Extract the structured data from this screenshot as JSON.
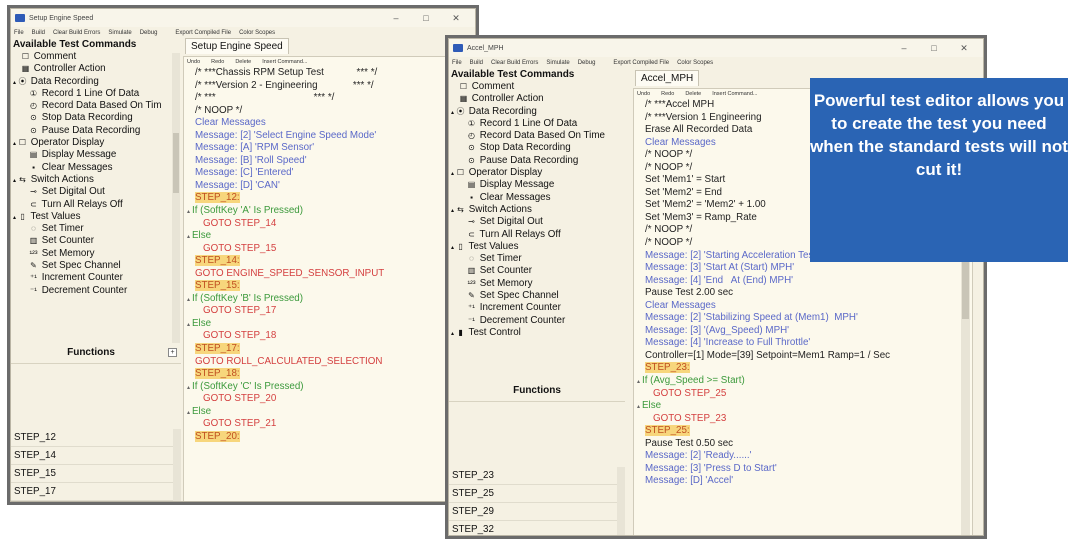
{
  "window1": {
    "title": "Setup Engine Speed",
    "menu": [
      "File",
      "Build",
      "Clear Build Errors",
      "Simulate",
      "Debug"
    ],
    "menu_right": [
      "Export Compiled File",
      "Color Scopes"
    ],
    "panel_header": "Available Test Commands",
    "tab": "Setup Engine Speed",
    "toolbar": [
      "Undo",
      "Redo",
      "Delete",
      "Insert Command..."
    ],
    "functions_label": "Functions",
    "steps": [
      "STEP_12",
      "STEP_14",
      "STEP_15",
      "STEP_17"
    ]
  },
  "window2": {
    "title": "Accel_MPH",
    "menu": [
      "File",
      "Build",
      "Clear Build Errors",
      "Simulate",
      "Debug"
    ],
    "menu_right": [
      "Export Compiled File",
      "Color Scopes"
    ],
    "panel_header": "Available Test Commands",
    "tab": "Accel_MPH",
    "toolbar": [
      "Undo",
      "Redo",
      "Delete",
      "Insert Command..."
    ],
    "functions_label": "Functions",
    "steps": [
      "STEP_23",
      "STEP_25",
      "STEP_29",
      "STEP_32"
    ]
  },
  "commands": {
    "w1": [
      {
        "t": "Comment",
        "icon": "comment-icon",
        "g": "☐",
        "lv": 0
      },
      {
        "t": "Controller Action",
        "icon": "controller-icon",
        "g": "▦",
        "lv": 0
      },
      {
        "t": "Data Recording",
        "icon": "record-icon",
        "g": "⦿",
        "lv": 0,
        "grp": true
      },
      {
        "t": "Record 1 Line Of Data",
        "icon": "record-line-icon",
        "g": "①",
        "lv": 1
      },
      {
        "t": "Record Data Based On Tim",
        "icon": "record-time-icon",
        "g": "◴",
        "lv": 1
      },
      {
        "t": "Stop Data Recording",
        "icon": "stop-icon",
        "g": "⊙",
        "lv": 1
      },
      {
        "t": "Pause Data Recording",
        "icon": "pause-icon",
        "g": "⊙",
        "lv": 1
      },
      {
        "t": "Operator Display",
        "icon": "display-icon",
        "g": "☐",
        "lv": 0,
        "grp": true
      },
      {
        "t": "Display Message",
        "icon": "message-icon",
        "g": "▤",
        "lv": 1
      },
      {
        "t": "Clear Messages",
        "icon": "clear-icon",
        "g": "▪",
        "lv": 1
      },
      {
        "t": "Switch Actions",
        "icon": "switch-icon",
        "g": "⇆",
        "lv": 0,
        "grp": true
      },
      {
        "t": "Set Digital Out",
        "icon": "digital-out-icon",
        "g": "⊸",
        "lv": 1
      },
      {
        "t": "Turn All Relays Off",
        "icon": "relays-icon",
        "g": "⊂",
        "lv": 1
      },
      {
        "t": "Test Values",
        "icon": "test-values-icon",
        "g": "▯",
        "lv": 0,
        "grp": true
      },
      {
        "t": "Set Timer",
        "icon": "timer-icon",
        "g": "◌",
        "lv": 1
      },
      {
        "t": "Set Counter",
        "icon": "counter-icon",
        "g": "▥",
        "lv": 1
      },
      {
        "t": "Set Memory",
        "icon": "memory-icon",
        "g": "¹²³",
        "lv": 1
      },
      {
        "t": "Set Spec Channel",
        "icon": "spec-icon",
        "g": "✎",
        "lv": 1
      },
      {
        "t": "Increment Counter",
        "icon": "increment-icon",
        "g": "⁺¹",
        "lv": 1
      },
      {
        "t": "Decrement Counter",
        "icon": "decrement-icon",
        "g": "⁻¹",
        "lv": 1
      }
    ],
    "w2": [
      {
        "t": "Comment",
        "icon": "comment-icon",
        "g": "☐",
        "lv": 0
      },
      {
        "t": "Controller Action",
        "icon": "controller-icon",
        "g": "▦",
        "lv": 0
      },
      {
        "t": "Data Recording",
        "icon": "record-icon",
        "g": "⦿",
        "lv": 0,
        "grp": true
      },
      {
        "t": "Record 1 Line Of Data",
        "icon": "record-line-icon",
        "g": "①",
        "lv": 1
      },
      {
        "t": "Record Data Based On Time",
        "icon": "record-time-icon",
        "g": "◴",
        "lv": 1
      },
      {
        "t": "Stop Data Recording",
        "icon": "stop-icon",
        "g": "⊙",
        "lv": 1
      },
      {
        "t": "Pause Data Recording",
        "icon": "pause-icon",
        "g": "⊙",
        "lv": 1
      },
      {
        "t": "Operator Display",
        "icon": "display-icon",
        "g": "☐",
        "lv": 0,
        "grp": true
      },
      {
        "t": "Display Message",
        "icon": "message-icon",
        "g": "▤",
        "lv": 1
      },
      {
        "t": "Clear Messages",
        "icon": "clear-icon",
        "g": "▪",
        "lv": 1
      },
      {
        "t": "Switch Actions",
        "icon": "switch-icon",
        "g": "⇆",
        "lv": 0,
        "grp": true
      },
      {
        "t": "Set Digital Out",
        "icon": "digital-out-icon",
        "g": "⊸",
        "lv": 1
      },
      {
        "t": "Turn All Relays Off",
        "icon": "relays-icon",
        "g": "⊂",
        "lv": 1
      },
      {
        "t": "Test Values",
        "icon": "test-values-icon",
        "g": "▯",
        "lv": 0,
        "grp": true
      },
      {
        "t": "Set Timer",
        "icon": "timer-icon",
        "g": "◌",
        "lv": 1
      },
      {
        "t": "Set Counter",
        "icon": "counter-icon",
        "g": "▥",
        "lv": 1
      },
      {
        "t": "Set Memory",
        "icon": "memory-icon",
        "g": "¹²³",
        "lv": 1
      },
      {
        "t": "Set Spec Channel",
        "icon": "spec-icon",
        "g": "✎",
        "lv": 1
      },
      {
        "t": "Increment Counter",
        "icon": "increment-icon",
        "g": "⁺¹",
        "lv": 1
      },
      {
        "t": "Decrement Counter",
        "icon": "decrement-icon",
        "g": "⁻¹",
        "lv": 1
      },
      {
        "t": "Test Control",
        "icon": "test-control-icon",
        "g": "▮",
        "lv": 0,
        "grp": true
      }
    ]
  },
  "editor1": [
    {
      "t": "/* ***Chassis RPM Setup Test            *** */",
      "c": ""
    },
    {
      "t": "/* ***Version 2 - Engineering             *** */",
      "c": ""
    },
    {
      "t": "/* ***                                    *** */",
      "c": ""
    },
    {
      "t": "/* NOOP */",
      "c": ""
    },
    {
      "t": "Clear Messages",
      "c": "blue"
    },
    {
      "t": "Message: [2] 'Select Engine Speed Mode'",
      "c": "blue"
    },
    {
      "t": "Message: [A] 'RPM Sensor'",
      "c": "blue"
    },
    {
      "t": "Message: [B] 'Roll Speed'",
      "c": "blue"
    },
    {
      "t": "Message: [C] 'Entered'",
      "c": "blue"
    },
    {
      "t": "Message: [D] 'CAN'",
      "c": "blue"
    },
    {
      "t": "STEP_12:",
      "c": "step"
    },
    {
      "t": "If (SoftKey 'A' Is Pressed)",
      "c": "green",
      "mk": true
    },
    {
      "t": "GOTO STEP_14",
      "c": "red",
      "ind": true
    },
    {
      "t": "Else",
      "c": "green",
      "mk": true
    },
    {
      "t": "GOTO STEP_15",
      "c": "red",
      "ind": true
    },
    {
      "t": "STEP_14:",
      "c": "step"
    },
    {
      "t": "GOTO ENGINE_SPEED_SENSOR_INPUT",
      "c": "red"
    },
    {
      "t": "STEP_15:",
      "c": "step"
    },
    {
      "t": "If (SoftKey 'B' Is Pressed)",
      "c": "green",
      "mk": true
    },
    {
      "t": "GOTO STEP_17",
      "c": "red",
      "ind": true
    },
    {
      "t": "Else",
      "c": "green",
      "mk": true
    },
    {
      "t": "GOTO STEP_18",
      "c": "red",
      "ind": true
    },
    {
      "t": "STEP_17:",
      "c": "step"
    },
    {
      "t": "GOTO ROLL_CALCULATED_SELECTION",
      "c": "red"
    },
    {
      "t": "STEP_18:",
      "c": "step"
    },
    {
      "t": "If (SoftKey 'C' Is Pressed)",
      "c": "green",
      "mk": true
    },
    {
      "t": "GOTO STEP_20",
      "c": "red",
      "ind": true
    },
    {
      "t": "Else",
      "c": "green",
      "mk": true
    },
    {
      "t": "GOTO STEP_21",
      "c": "red",
      "ind": true
    },
    {
      "t": "STEP_20:",
      "c": "step"
    }
  ],
  "editor2": [
    {
      "t": "/* ***Accel MPH",
      "c": ""
    },
    {
      "t": "/* ***Version 1 Engineering",
      "c": ""
    },
    {
      "t": "Erase All Recorded Data",
      "c": ""
    },
    {
      "t": "Clear Messages",
      "c": "blue"
    },
    {
      "t": "/* NOOP */",
      "c": ""
    },
    {
      "t": "/* NOOP */",
      "c": ""
    },
    {
      "t": "Set 'Mem1' = Start",
      "c": ""
    },
    {
      "t": "Set 'Mem2' = End",
      "c": ""
    },
    {
      "t": "Set 'Mem2' = 'Mem2' + 1.00",
      "c": ""
    },
    {
      "t": "Set 'Mem3' = Ramp_Rate",
      "c": ""
    },
    {
      "t": "/* NOOP */",
      "c": ""
    },
    {
      "t": "/* NOOP */",
      "c": ""
    },
    {
      "t": "Message: [2] 'Starting Acceleration Test'",
      "c": "blue"
    },
    {
      "t": "Message: [3] 'Start At (Start) MPH'",
      "c": "blue"
    },
    {
      "t": "Message: [4] 'End   At (End) MPH'",
      "c": "blue"
    },
    {
      "t": "Pause Test 2.00 sec",
      "c": ""
    },
    {
      "t": "Clear Messages",
      "c": "blue"
    },
    {
      "t": "Message: [2] 'Stabilizing Speed at (Mem1)  MPH'",
      "c": "blue"
    },
    {
      "t": "Message: [3] '(Avg_Speed) MPH'",
      "c": "blue"
    },
    {
      "t": "Message: [4] 'Increase to Full Throttle'",
      "c": "blue"
    },
    {
      "t": "Controller=[1] Mode=[39] Setpoint=Mem1 Ramp=1 / Sec",
      "c": ""
    },
    {
      "t": "STEP_23:",
      "c": "step"
    },
    {
      "t": "If (Avg_Speed >= Start)",
      "c": "green",
      "mk": true
    },
    {
      "t": "GOTO STEP_25",
      "c": "red",
      "ind": true
    },
    {
      "t": "Else",
      "c": "green",
      "mk": true
    },
    {
      "t": "GOTO STEP_23",
      "c": "red",
      "ind": true
    },
    {
      "t": "STEP_25:",
      "c": "step"
    },
    {
      "t": "Pause Test 0.50 sec",
      "c": ""
    },
    {
      "t": "Message: [2] 'Ready......'",
      "c": "blue"
    },
    {
      "t": "Message: [3] 'Press D to Start'",
      "c": "blue"
    },
    {
      "t": "Message: [D] 'Accel'",
      "c": "blue"
    }
  ],
  "callout": "Powerful test editor allows you to create the test you need when the standard tests will not cut it!",
  "colors": {
    "accent": "#2a64b4",
    "step_bg": "#f7d67c",
    "message": "#5a68c8",
    "goto": "#d44040",
    "condition": "#3c9a3c"
  }
}
